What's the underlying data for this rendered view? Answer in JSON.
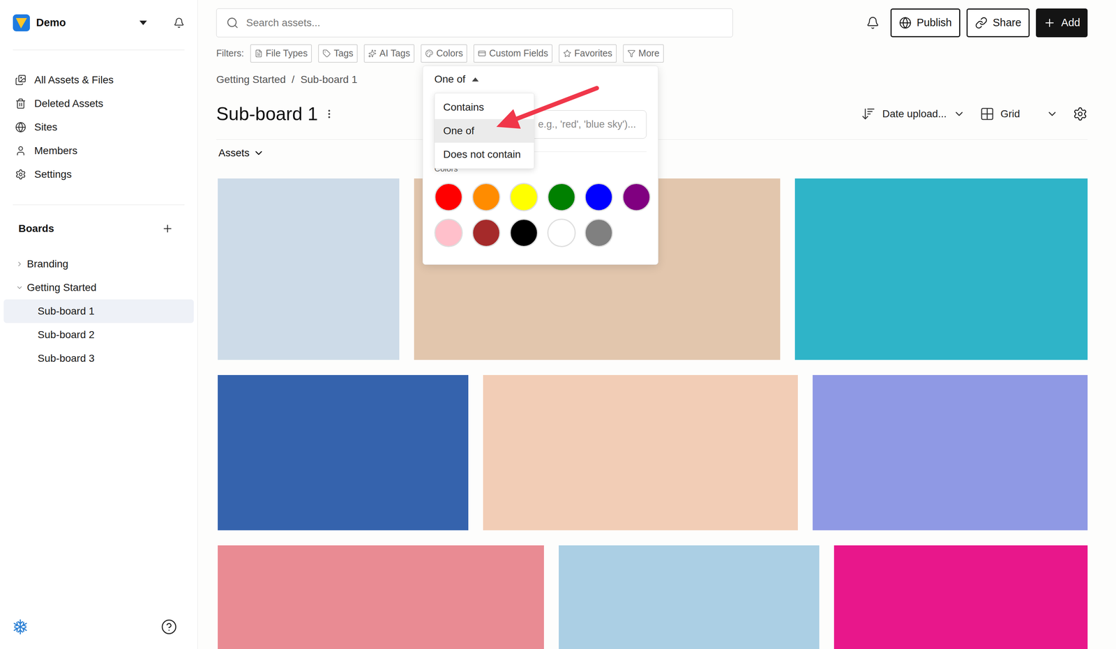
{
  "workspace": {
    "name": "Demo"
  },
  "nav": [
    {
      "label": "All Assets & Files",
      "icon": "assets"
    },
    {
      "label": "Deleted Assets",
      "icon": "trash"
    },
    {
      "label": "Sites",
      "icon": "globe"
    },
    {
      "label": "Members",
      "icon": "user"
    },
    {
      "label": "Settings",
      "icon": "gear"
    }
  ],
  "boards": {
    "title": "Boards",
    "items": [
      {
        "label": "Branding",
        "expanded": false,
        "selected": false,
        "children": []
      },
      {
        "label": "Getting Started",
        "expanded": true,
        "selected": false,
        "children": [
          {
            "label": "Sub-board 1",
            "selected": true
          },
          {
            "label": "Sub-board 2",
            "selected": false
          },
          {
            "label": "Sub-board 3",
            "selected": false
          }
        ]
      }
    ]
  },
  "search": {
    "placeholder": "Search assets..."
  },
  "header_buttons": [
    {
      "label": "Publish",
      "kind": "outline",
      "icon": "globe"
    },
    {
      "label": "Share",
      "kind": "outline",
      "icon": "link"
    },
    {
      "label": "Add",
      "kind": "primary",
      "icon": "plus"
    }
  ],
  "filters": {
    "label": "Filters:",
    "chips": [
      {
        "label": "File Types",
        "icon": "file"
      },
      {
        "label": "Tags",
        "icon": "tag"
      },
      {
        "label": "AI Tags",
        "icon": "ai"
      },
      {
        "label": "Colors",
        "icon": "palette"
      },
      {
        "label": "Custom Fields",
        "icon": "card"
      },
      {
        "label": "Favorites",
        "icon": "star"
      },
      {
        "label": "More",
        "icon": "funnel"
      }
    ]
  },
  "breadcrumb": {
    "separator": "/",
    "items": [
      "Getting Started",
      "Sub-board 1"
    ]
  },
  "title": "Sub-board 1",
  "sort": "Date upload...",
  "view": "Grid",
  "section": "Assets",
  "filter_popover": {
    "operator": "One of",
    "expanded": true,
    "options": [
      {
        "label": "Contains",
        "selected": false
      },
      {
        "label": "One of",
        "selected": true
      },
      {
        "label": "Does not contain",
        "selected": false
      }
    ],
    "input_placeholder": "e.g., 'red', 'blue sky')...",
    "colors_label": "Colors",
    "swatches": [
      {
        "color": "#ff0000",
        "selected": false
      },
      {
        "color": "#ff8c00",
        "selected": false
      },
      {
        "color": "#ffff00",
        "selected": false
      },
      {
        "color": "#008000",
        "selected": false
      },
      {
        "color": "#0000ff",
        "selected": false
      },
      {
        "color": "#800080",
        "selected": false
      },
      {
        "color": "#ffc0cb",
        "selected": false
      },
      {
        "color": "#a52a2a",
        "selected": false
      },
      {
        "color": "#000000",
        "selected": false
      },
      {
        "color": "#ffffff",
        "selected": false
      },
      {
        "color": "#808080",
        "selected": false
      }
    ]
  },
  "assets": [
    {
      "color": "#cddbe8"
    },
    {
      "color": "#e2c6ad"
    },
    {
      "color": "#2fb4c8"
    },
    {
      "color": "#3563ad"
    },
    {
      "color": "#f2cdb6"
    },
    {
      "color": "#8f99e4"
    },
    {
      "color": "#e98b93"
    },
    {
      "color": "#abcfe4"
    },
    {
      "color": "#e8178b"
    }
  ]
}
